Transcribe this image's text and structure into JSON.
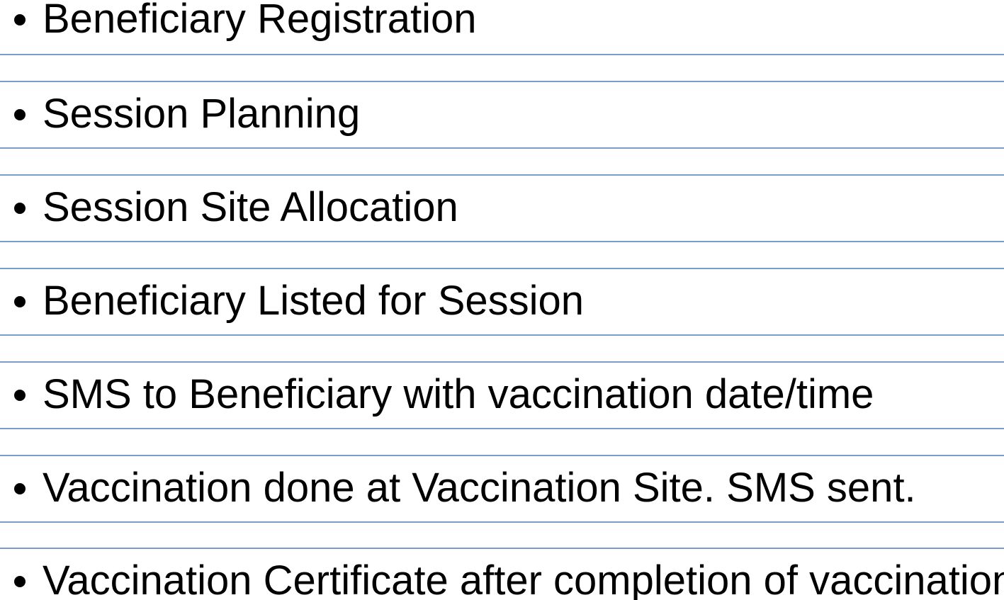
{
  "items": [
    "Beneficiary Registration",
    "Session Planning",
    "Session Site Allocation",
    "Beneficiary Listed for Session",
    "SMS to Beneficiary with vaccination date/time",
    "Vaccination done at Vaccination Site. SMS sent.",
    "Vaccination Certificate after completion of vaccination"
  ],
  "colors": {
    "rule_line": "#7a9cc6",
    "text": "#000000",
    "background": "#ffffff"
  }
}
